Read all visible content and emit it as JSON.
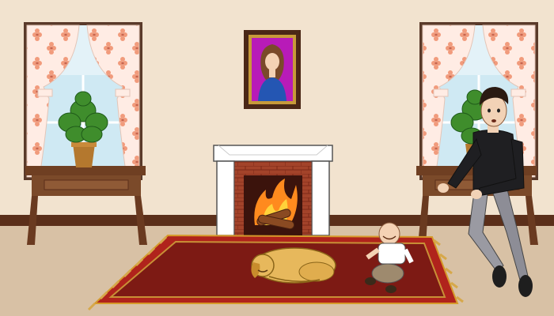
{
  "scene": {
    "name": "living-room",
    "objects": [
      "left-window",
      "right-window",
      "left-side-table",
      "right-side-table",
      "potted-plant-left",
      "potted-plant-right",
      "framed-portrait",
      "fireplace",
      "rug",
      "sleeping-dog",
      "baby",
      "man-sitting"
    ]
  },
  "colors": {
    "wall": "#f2e3cf",
    "floor": "#d6c0a4",
    "baseboard": "#5b2f1a",
    "rug": "#7d1a14",
    "rug_border": "#b0231c",
    "fireplace_white": "#ffffff",
    "fireplace_brick": "#9c3a24",
    "fire": "#ff8a1e",
    "curtain": "#ffe8df",
    "curtain_flower": "#f08a6a",
    "window_sky": "#d8eef6",
    "table_wood": "#7b4a2a",
    "dog": "#e7b85c",
    "frame": "#4a2716",
    "portrait_bg": "#b81bb8"
  }
}
